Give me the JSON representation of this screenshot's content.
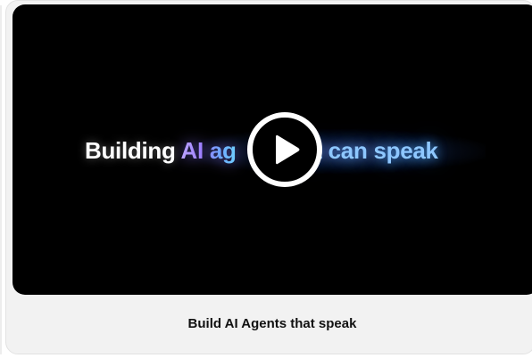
{
  "video_card": {
    "headline": {
      "part1": "Building ",
      "part2": "AI ag",
      "part3": "hat can speak"
    },
    "caption": "Build AI Agents that speak",
    "play_icon": "play-icon",
    "colors": {
      "video_bg": "#000000",
      "card_bg": "#f2f2f2",
      "accent_purple": "#9b7dff",
      "accent_blue": "#8ec7ff",
      "caption_text": "#111111"
    }
  }
}
